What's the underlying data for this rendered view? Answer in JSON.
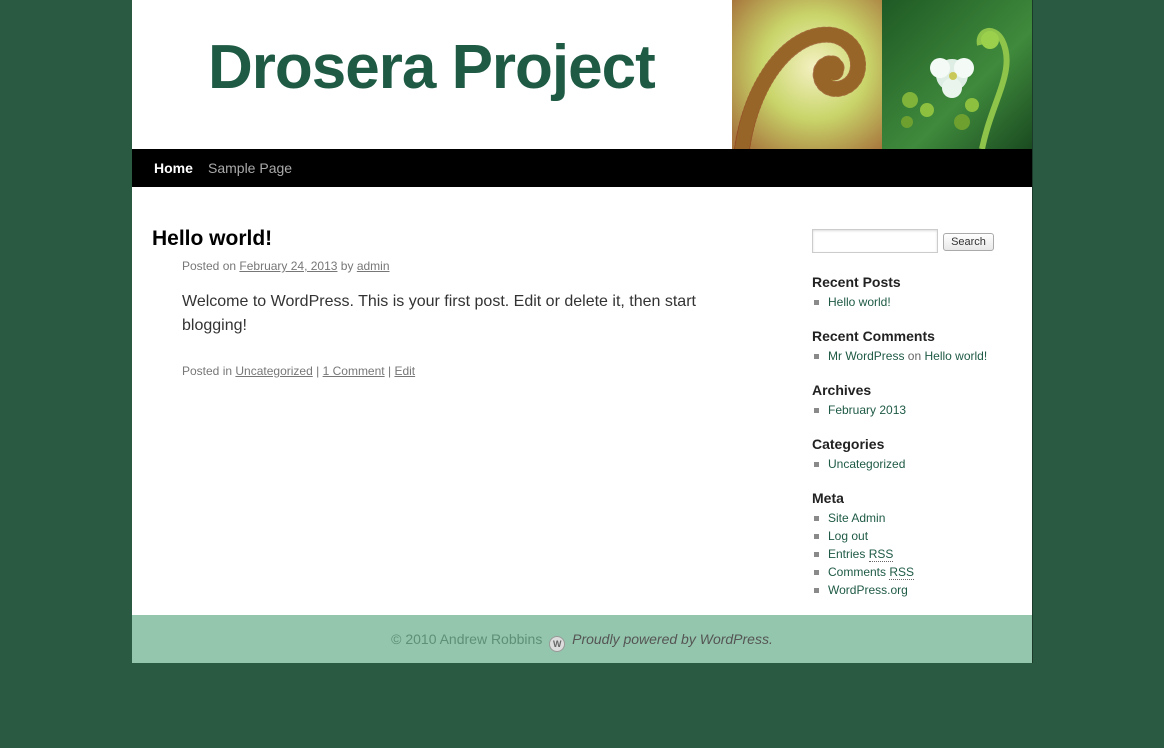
{
  "site": {
    "title": "Drosera Project"
  },
  "header_image": {
    "description": "Drosera plant images",
    "colors": {
      "left": "#c9d86a",
      "right": "#2e6b2e"
    }
  },
  "nav": {
    "items": [
      {
        "label": "Home",
        "current": true
      },
      {
        "label": "Sample Page",
        "current": false
      }
    ]
  },
  "post": {
    "title": "Hello world!",
    "meta_prefix": "Posted on",
    "date": "February 24, 2013",
    "by": "by",
    "author": "admin",
    "content": "Welcome to WordPress. This is your first post. Edit or delete it, then start blogging!",
    "utility_prefix": "Posted in",
    "category": "Uncategorized",
    "comments": "1 Comment",
    "edit": "Edit",
    "separator": "|"
  },
  "search": {
    "button": "Search",
    "placeholder": ""
  },
  "sidebar": {
    "recent_posts": {
      "title": "Recent Posts",
      "items": [
        "Hello world!"
      ]
    },
    "recent_comments": {
      "title": "Recent Comments",
      "author": "Mr WordPress",
      "on": "on",
      "post": "Hello world!"
    },
    "archives": {
      "title": "Archives",
      "items": [
        "February 2013"
      ]
    },
    "categories": {
      "title": "Categories",
      "items": [
        "Uncategorized"
      ]
    },
    "meta": {
      "title": "Meta",
      "site_admin": "Site Admin",
      "log_out": "Log out",
      "entries": "Entries",
      "comments": "Comments",
      "rss": "RSS",
      "wordpress_org": "WordPress.org"
    }
  },
  "footer": {
    "copyright": "© 2010 Andrew Robbins",
    "powered": "Proudly powered by WordPress."
  },
  "colors": {
    "page_background": "#2b5a42",
    "title": "#1e5a44",
    "footer": "#94c6ad",
    "nav_bar": "#000000"
  }
}
